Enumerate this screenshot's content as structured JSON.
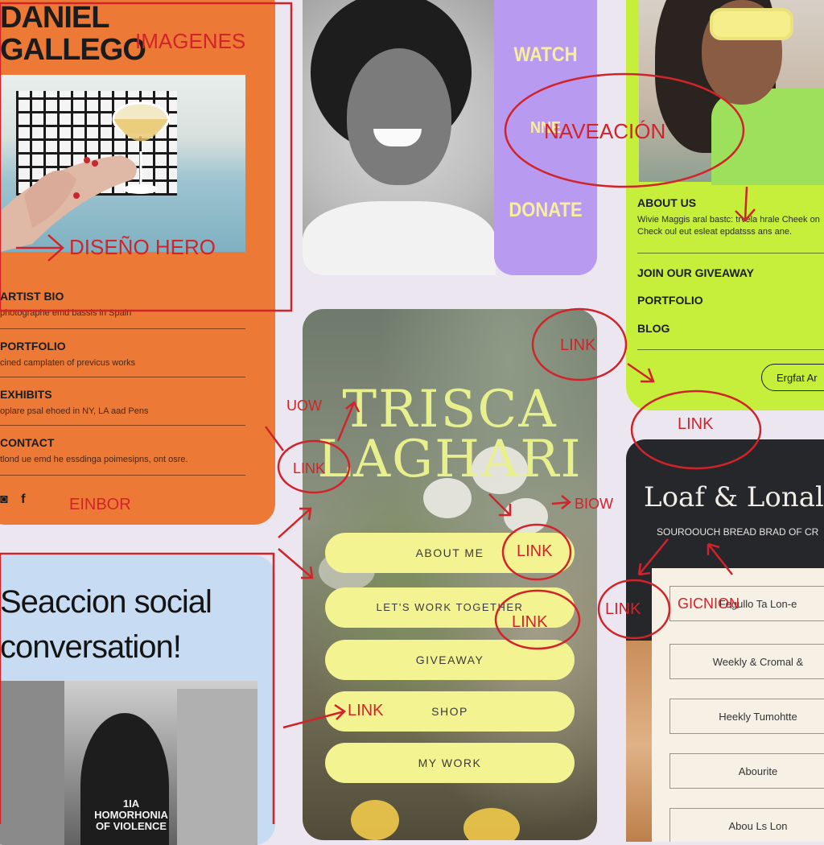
{
  "orange_card": {
    "title": "DANIEL\nGALLEGO",
    "menu": [
      {
        "heading": "ARTIST BIO",
        "desc": "photographe emd bassis in Spain"
      },
      {
        "heading": "PORTFOLIO",
        "desc": "cined camplaten of previcus works"
      },
      {
        "heading": "EXHIBITS",
        "desc": "oplare psal ehoed in NY, LA aad Pens"
      },
      {
        "heading": "CONTACT",
        "desc": "tlond ue emd he essdinga poimesipns, ont osre."
      }
    ],
    "social_icons": [
      "instagram-icon",
      "facebook-icon"
    ],
    "social_glyphs": [
      "◙",
      "f"
    ],
    "bg_color": "#ec7a36"
  },
  "nav_card": {
    "items": [
      "WATCH",
      "NNE",
      "DONATE"
    ],
    "bg_color": "#b89bf0"
  },
  "green_card": {
    "about_label": "ABOUT US",
    "about_desc": "Wivie Maggis aral bastc: trvela hrale Cheek on Check oul eut esleat epdatsss ans ane.",
    "links": [
      "JOIN OUR GIVEAWAY",
      "PORTFOLIO",
      "BLOG"
    ],
    "pill_label": "Ergfat Ar",
    "bg_color": "#c5ef3a"
  },
  "link_card": {
    "name_line1": "TRISCA",
    "name_line2": "LAGHARI",
    "buttons": [
      "ABOUT ME",
      "LET'S WORK TOGETHER",
      "GIVEAWAY",
      "SHOP",
      "MY WORK"
    ],
    "button_color": "#f4f391"
  },
  "social_card": {
    "heading_line1": "Seaccion social",
    "heading_line2": "conversation!",
    "shirt_text_line1": "1IA HOMORHONIA",
    "shirt_text_line2": "OF VIOLENCE",
    "bg_color": "#c7dcf3"
  },
  "bakery_card": {
    "title": "Loaf & Lonal",
    "subtitle": "SOUROOUCH BREAD BRAD OF CR",
    "options": [
      "Fegullo Ta Lon-e",
      "Weekly & Cromal &",
      "Heekly Tumohtte",
      "Abourite",
      "Abou Ls Lon"
    ]
  },
  "annotations": {
    "imagenes": "IMAGENES",
    "diseno_hero": "DISEÑO HERO",
    "navegacion": "NAVEACIÓN",
    "link": "LINK",
    "link_words": [
      "LINK",
      "LINK",
      "LINK",
      "LINK",
      "LINK",
      "LINK",
      "LINK"
    ],
    "uow": "UOW",
    "biow": "BIOW",
    "einbor": "EINBOR",
    "gicnion": "GICNION",
    "color": "#d1242a"
  }
}
